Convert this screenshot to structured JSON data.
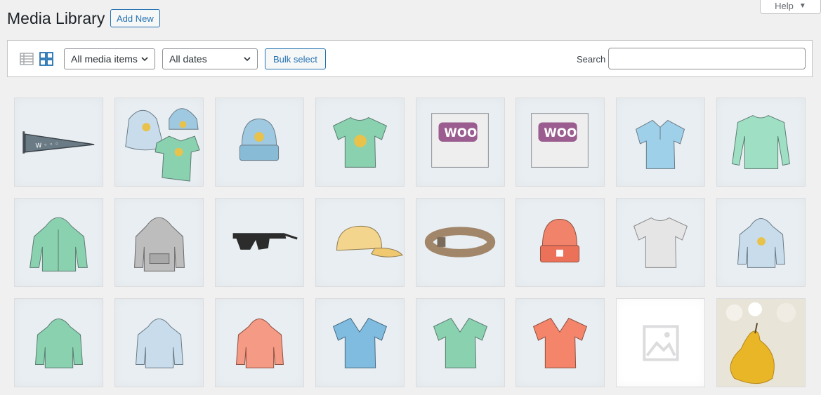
{
  "help": {
    "label": "Help",
    "caret": "▼"
  },
  "header": {
    "title": "Media Library",
    "add_new_label": "Add New"
  },
  "toolbar": {
    "type_filter": "All media items",
    "date_filter": "All dates",
    "bulk_select_label": "Bulk select",
    "search_label": "Search",
    "search_value": ""
  },
  "colors": {
    "accent": "#2271b1",
    "background": "#f0f0f1",
    "tile": "#e9eef2"
  },
  "media_items": [
    {
      "icon": "pennant-image"
    },
    {
      "icon": "hoodie-beanie-tshirt-image"
    },
    {
      "icon": "beanie-image"
    },
    {
      "icon": "tshirt-logo-image"
    },
    {
      "icon": "woo-single-image"
    },
    {
      "icon": "woo-album-image"
    },
    {
      "icon": "polo-image"
    },
    {
      "icon": "long-sleeve-image"
    },
    {
      "icon": "hoodie-zip-image"
    },
    {
      "icon": "hoodie-gray-image"
    },
    {
      "icon": "sunglasses-image"
    },
    {
      "icon": "cap-image"
    },
    {
      "icon": "belt-image"
    },
    {
      "icon": "beanie-orange-image"
    },
    {
      "icon": "tshirt-gray-image"
    },
    {
      "icon": "hoodie-logo-image"
    },
    {
      "icon": "hoodie-green-image"
    },
    {
      "icon": "hoodie-blue-image"
    },
    {
      "icon": "hoodie-red-image"
    },
    {
      "icon": "vneck-blue-image"
    },
    {
      "icon": "vneck-green-image"
    },
    {
      "icon": "vneck-red-image"
    },
    {
      "icon": "placeholder-image"
    },
    {
      "icon": "pear-photo-image"
    }
  ]
}
